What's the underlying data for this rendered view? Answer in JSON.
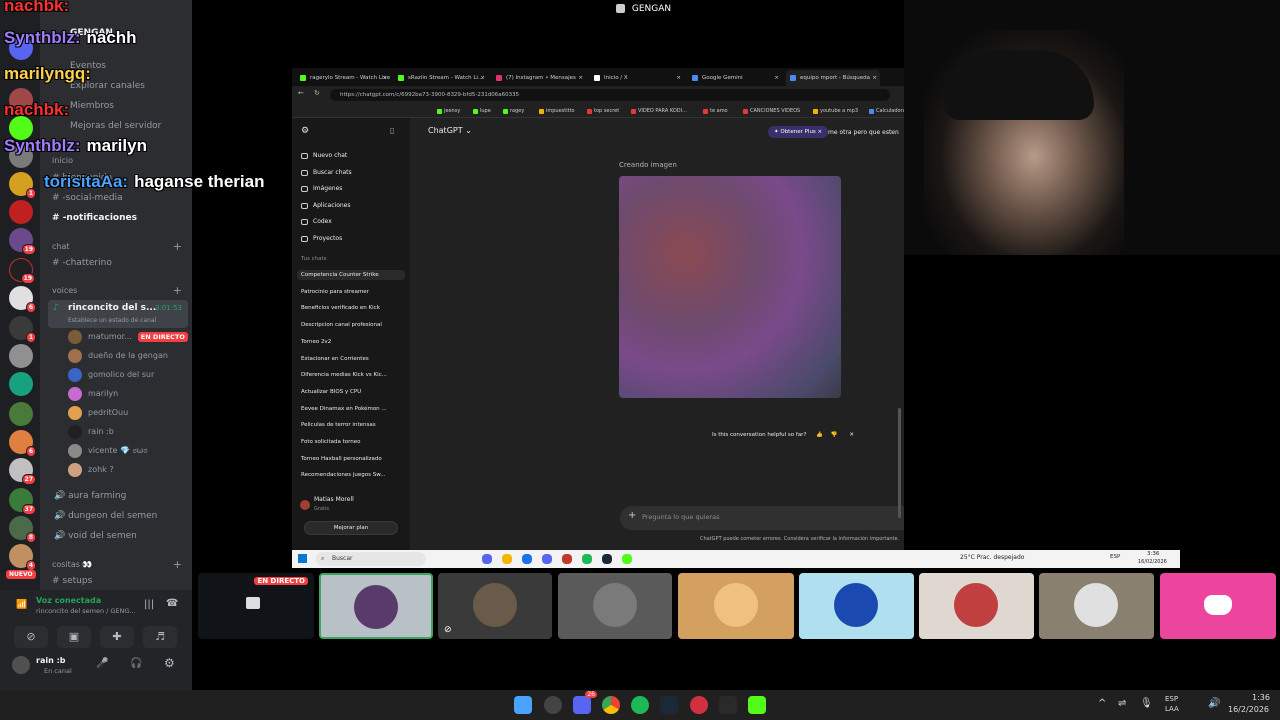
{
  "window_title": "GENGAN",
  "overlay_chat": [
    {
      "user": "nachbk:",
      "message": "",
      "color": "#ff3030"
    },
    {
      "user": "Synthblz:",
      "message": "nachh",
      "color": "#a07cff"
    },
    {
      "user": "marilyngq:",
      "message": "",
      "color": "#ffd24a"
    },
    {
      "user": "nachbk:",
      "message": "",
      "color": "#ff3030"
    },
    {
      "user": "Synthblz:",
      "message": "marilyn",
      "color": "#a07cff"
    },
    {
      "user": "torisitaAa:",
      "message": "haganse therian",
      "color": "#4aa3ff"
    }
  ],
  "discord": {
    "server_name": "GENGAN",
    "menu": {
      "events": "Eventos",
      "explore": "Explorar canales",
      "members": "Miembros",
      "improve": "Mejoras del servidor"
    },
    "inicio_label": "inicio",
    "text_channels": [
      {
        "name": "bienvenida"
      },
      {
        "name": "-social-media"
      },
      {
        "name": "-notificaciones"
      }
    ],
    "chat_category": "chat",
    "chat_channels": [
      {
        "name": "-chatterino"
      }
    ],
    "voices_category": "voices",
    "active_voice": {
      "name": "rinconcito del s...",
      "timer": "3:01:53",
      "status": "Establece un estado de canal"
    },
    "voice_users": [
      {
        "name": "matumor...",
        "live": "EN DIRECTO",
        "color": "#7a5c3a"
      },
      {
        "name": "dueño de la gengan",
        "color": "#a0704a"
      },
      {
        "name": "gomolico del sur",
        "color": "#3a64c8"
      },
      {
        "name": "marilyn",
        "color": "#c86ad0"
      },
      {
        "name": "pedritOuu",
        "color": "#e0a050"
      },
      {
        "name": "rain :b",
        "color": "#202020"
      },
      {
        "name": "vicente 💎 ಠωಠ",
        "color": "#8a8a8a"
      },
      {
        "name": "zohk ?",
        "color": "#cfa080"
      }
    ],
    "other_voice": [
      {
        "name": "aura farming"
      },
      {
        "name": "dungeon del semen"
      },
      {
        "name": "void del semen"
      }
    ],
    "cositas_category": "cositas 👀",
    "setups_channel": "setups",
    "new_badge": "NUEVO",
    "voice_panel": {
      "status": "Voz conectada",
      "channel": "rinconcito del semen / GENG...",
      "user": "rain :b",
      "user_status": "En canal"
    },
    "rail_badges": [
      "1",
      "19",
      "19",
      "6",
      "1",
      "6",
      "27",
      "37",
      "8",
      "4"
    ]
  },
  "browser": {
    "tabs": [
      {
        "label": "ragerylo Stream - Watch Live...",
        "color": "#53fc18"
      },
      {
        "label": "sRaziin Stream - Watch Li...",
        "color": "#53fc18"
      },
      {
        "label": "(7) Instagram • Mensajes",
        "color": "#e1306c"
      },
      {
        "label": "Inicio / X",
        "color": "#ffffff"
      },
      {
        "label": "Google Gemini",
        "color": "#4a8af4"
      },
      {
        "label": "equipo mport - Búsqueda",
        "color": "#4a8af4"
      }
    ],
    "url": "https://chatgpt.com/c/6992ba73-3900-8329-bfd5-231d06a60335",
    "bookmarks": [
      {
        "label": "jeensy",
        "color": "#53fc18"
      },
      {
        "label": "lupe",
        "color": "#53fc18"
      },
      {
        "label": "ragey",
        "color": "#53fc18"
      },
      {
        "label": "impuestitto",
        "color": "#f4b400"
      },
      {
        "label": "top secret",
        "color": "#e53935"
      },
      {
        "label": "VIDEO PARA KODI...",
        "color": "#e53935"
      },
      {
        "label": "te amo",
        "color": "#e53935"
      },
      {
        "label": "CANCIONES VIDEOS",
        "color": "#e53935"
      },
      {
        "label": "youtube a mp3",
        "color": "#f4b400"
      },
      {
        "label": "Calculadora",
        "color": "#4a8af4"
      }
    ]
  },
  "chatgpt": {
    "title": "ChatGPT",
    "upgrade_pill": "Obtener Plus",
    "nav": [
      "Nuevo chat",
      "Buscar chats",
      "Imágenes",
      "Aplicaciones",
      "Codex",
      "Proyectos"
    ],
    "chats_heading": "Tus chats",
    "chats": [
      "Competencia Counter Strike",
      "Patrocinio para streamer",
      "Beneficios verificado en Kick",
      "Descripcion canal profesional",
      "Torneo 2v2",
      "Estacionar en Corrientes",
      "Diferencia medias Kick vs Kic...",
      "Actualizar BIOS y CPU",
      "Eevee Dinamax en Pokémon ...",
      "Peliculas de terror intensas",
      "Foto solicitada torneo",
      "Torneo Haxball personalizado",
      "Recomendaciones juegos Sw..."
    ],
    "user_name": "Matias Morell",
    "user_plan": "Gratis",
    "upgrade_button": "Mejorar plan",
    "partial_message": "me otra pero que esten",
    "creating_label": "Creando imagen",
    "feedback": "Is this conversation helpful so far?",
    "placeholder": "Pregunta lo que quieras",
    "disclaimer": "ChatGPT puede cometer errores. Considera verificar la información importante."
  },
  "win_taskbar": {
    "search": "Buscar",
    "weather": "25°C  Prac. despejado",
    "lang": "ESP",
    "time": "3:36",
    "date": "16/02/2026"
  },
  "stream_tiles": {
    "live_label": "EN DIRECTO"
  },
  "taskbar": {
    "lang_top": "ESP",
    "lang_bottom": "LAA",
    "time": "1:36",
    "date": "16/2/2026",
    "discord_badge": "26"
  }
}
